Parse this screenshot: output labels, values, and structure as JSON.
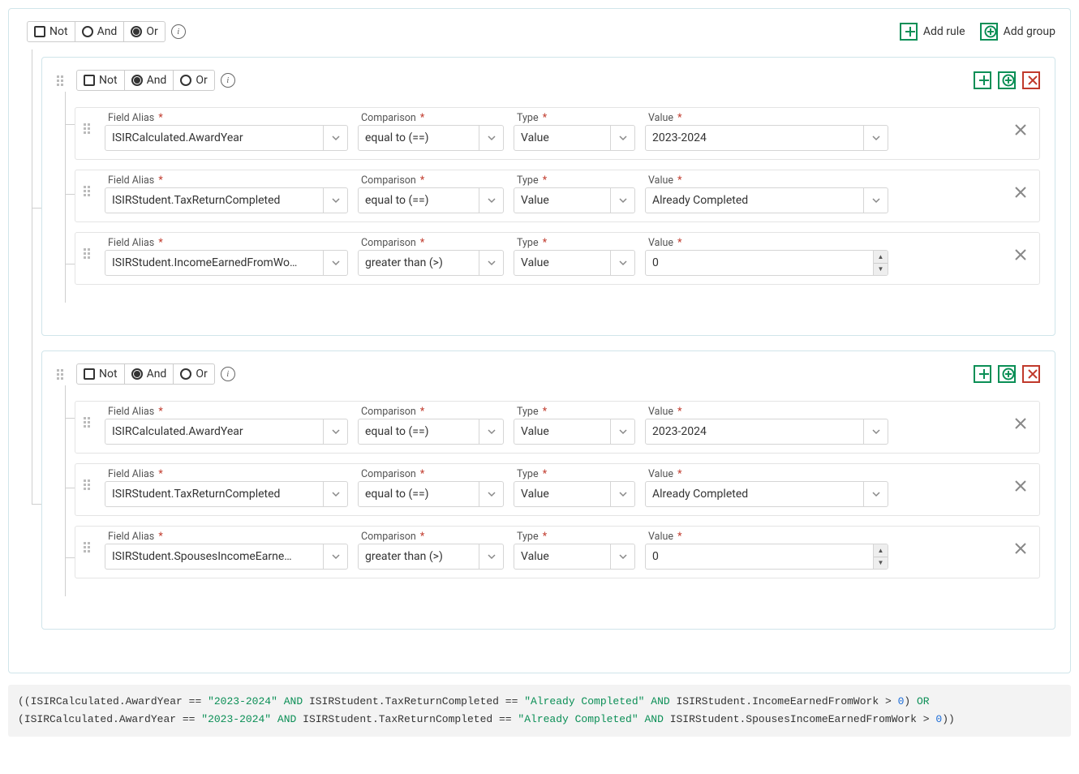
{
  "labels": {
    "not": "Not",
    "and": "And",
    "or": "Or",
    "add_rule": "Add rule",
    "add_group": "Add group",
    "field_alias": "Field Alias",
    "comparison": "Comparison",
    "type": "Type",
    "value": "Value"
  },
  "root": {
    "not": false,
    "conj": "or"
  },
  "groups": [
    {
      "not": false,
      "conj": "and",
      "rules": [
        {
          "field": "ISIRCalculated.AwardYear",
          "comparison": "equal to (==)",
          "type": "Value",
          "value": "2023-2024",
          "value_kind": "select"
        },
        {
          "field": "ISIRStudent.TaxReturnCompleted",
          "comparison": "equal to (==)",
          "type": "Value",
          "value": "Already Completed",
          "value_kind": "select"
        },
        {
          "field": "ISIRStudent.IncomeEarnedFromWo…",
          "comparison": "greater than (>)",
          "type": "Value",
          "value": "0",
          "value_kind": "number"
        }
      ]
    },
    {
      "not": false,
      "conj": "and",
      "rules": [
        {
          "field": "ISIRCalculated.AwardYear",
          "comparison": "equal to (==)",
          "type": "Value",
          "value": "2023-2024",
          "value_kind": "select"
        },
        {
          "field": "ISIRStudent.TaxReturnCompleted",
          "comparison": "equal to (==)",
          "type": "Value",
          "value": "Already Completed",
          "value_kind": "select"
        },
        {
          "field": "ISIRStudent.SpousesIncomeEarne…",
          "comparison": "greater than (>)",
          "type": "Value",
          "value": "0",
          "value_kind": "number"
        }
      ]
    }
  ],
  "expression": {
    "line1": {
      "prefix": "((",
      "parts": [
        {
          "field": "ISIRCalculated.AwardYear",
          "op": "==",
          "str": "\"2023-2024\""
        },
        {
          "kw": "AND"
        },
        {
          "field": "ISIRStudent.TaxReturnCompleted",
          "op": "==",
          "str": "\"Already Completed\""
        },
        {
          "kw": "AND"
        },
        {
          "field": "ISIRStudent.IncomeEarnedFromWork",
          "op": ">",
          "num": "0"
        }
      ],
      "suffix": ") ",
      "trailkw": "OR"
    },
    "line2": {
      "prefix": "(",
      "parts": [
        {
          "field": "ISIRCalculated.AwardYear",
          "op": "==",
          "str": "\"2023-2024\""
        },
        {
          "kw": "AND"
        },
        {
          "field": "ISIRStudent.TaxReturnCompleted",
          "op": "==",
          "str": "\"Already Completed\""
        },
        {
          "kw": "AND"
        },
        {
          "field": "ISIRStudent.SpousesIncomeEarnedFromWork",
          "op": ">",
          "num": "0"
        }
      ],
      "suffix": "))"
    }
  }
}
